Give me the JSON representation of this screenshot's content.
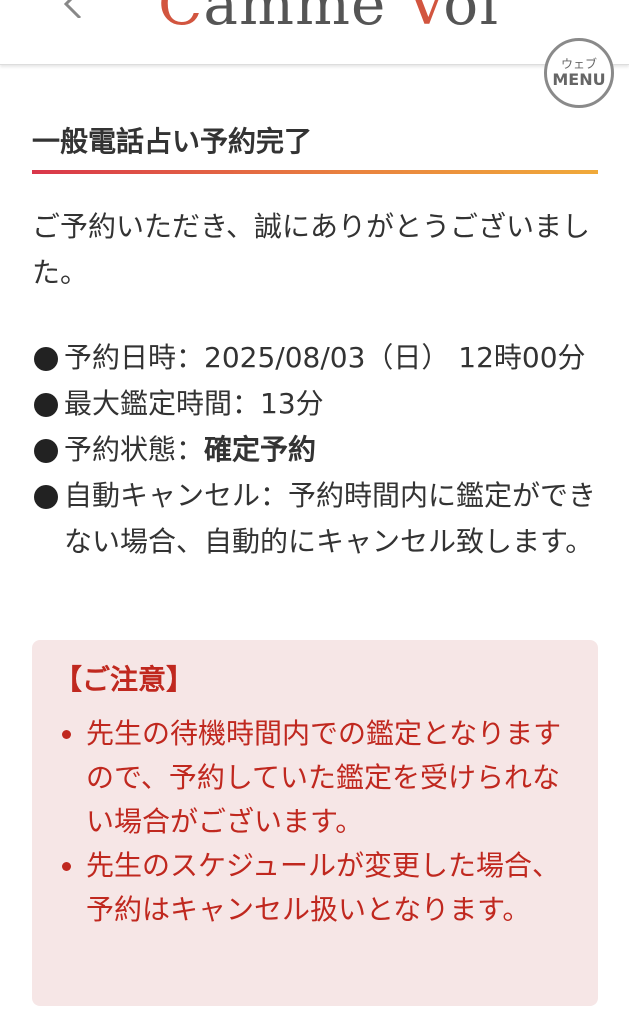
{
  "header": {
    "logo_initial": "C",
    "logo_text": "amme Voi",
    "logo_v": "V",
    "logo_end": "oi",
    "menu_sub": "ウェブ",
    "menu_label": "MENU"
  },
  "page": {
    "title": "一般電話占い予約完了",
    "intro": "ご予約いただき、誠にありがとうございました。"
  },
  "details": [
    {
      "label": "予約日時：",
      "value": "2025/08/03（日） 12時00分"
    },
    {
      "label": "最大鑑定時間：",
      "value": "13分"
    },
    {
      "label": "予約状態：",
      "value": "確定予約"
    },
    {
      "label": "自動キャンセル：",
      "value": "予約時間内に鑑定ができない場合、自動的にキャンセル致します。"
    }
  ],
  "notice": {
    "title": "【ご注意】",
    "items": [
      "先生の待機時間内での鑑定となりますので、予約していた鑑定を受けられない場合がございます。",
      "先生のスケジュールが変更した場合、予約はキャンセル扱いとなります。"
    ]
  },
  "colors": {
    "accent": "#d9364a",
    "notice_bg": "#f6e6e6",
    "notice_text": "#c0281f"
  }
}
